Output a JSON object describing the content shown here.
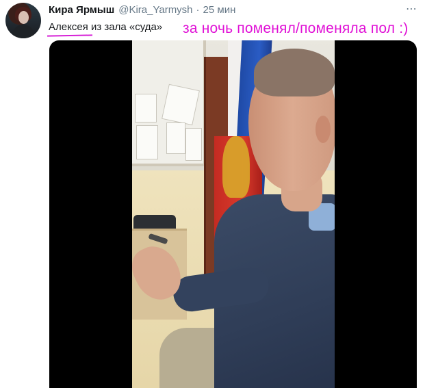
{
  "tweet": {
    "author_name": "Кира Ярмыш",
    "handle": "@Kira_Yarmysh",
    "separator": "·",
    "timestamp": "25 мин",
    "more_label": "⋯",
    "text": "Алексея из зала «суда»",
    "annotation": "за ночь поменял/поменяла пол :)"
  },
  "colors": {
    "annotation": "#e011d6",
    "name": "#14171a",
    "secondary": "#657786",
    "media_background": "#000000"
  },
  "icons": {
    "more": "more-horizontal-icon"
  },
  "media": {
    "type": "video"
  }
}
